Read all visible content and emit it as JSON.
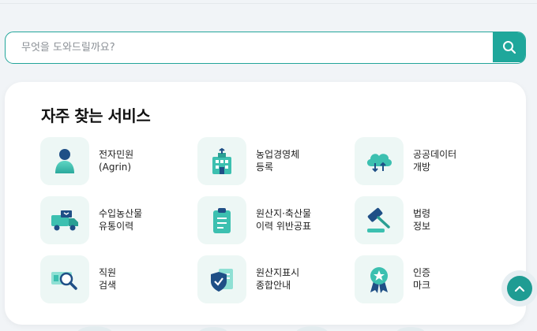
{
  "search": {
    "placeholder": "무엇을 도와드릴까요?",
    "button_icon": "search-icon"
  },
  "services": {
    "title": "자주 찾는 서비스",
    "items": [
      {
        "line1": "전자민원",
        "line2": "(Agrin)",
        "icon": "person-icon"
      },
      {
        "line1": "농업경영체",
        "line2": "등록",
        "icon": "building-icon"
      },
      {
        "line1": "공공데이터",
        "line2": "개방",
        "icon": "cloud-icon"
      },
      {
        "line1": "수입농산물",
        "line2": "유통이력",
        "icon": "truck-icon"
      },
      {
        "line1": "원산지·축산물",
        "line2": "이력 위반공표",
        "icon": "clipboard-icon"
      },
      {
        "line1": "법령",
        "line2": "정보",
        "icon": "gavel-icon"
      },
      {
        "line1": "직원",
        "line2": "검색",
        "icon": "magnifier-card-icon"
      },
      {
        "line1": "원산지표시",
        "line2": "종합안내",
        "icon": "shield-document-icon"
      },
      {
        "line1": "인증",
        "line2": "마크",
        "icon": "award-badge-icon"
      }
    ]
  },
  "scroll_top": {
    "icon": "chevron-up-icon"
  },
  "colors": {
    "accent": "#1fa79b",
    "accent_dark": "#1f6f8b",
    "icon_bg": "#edf7f5",
    "page_bg": "#f1f4f7"
  }
}
